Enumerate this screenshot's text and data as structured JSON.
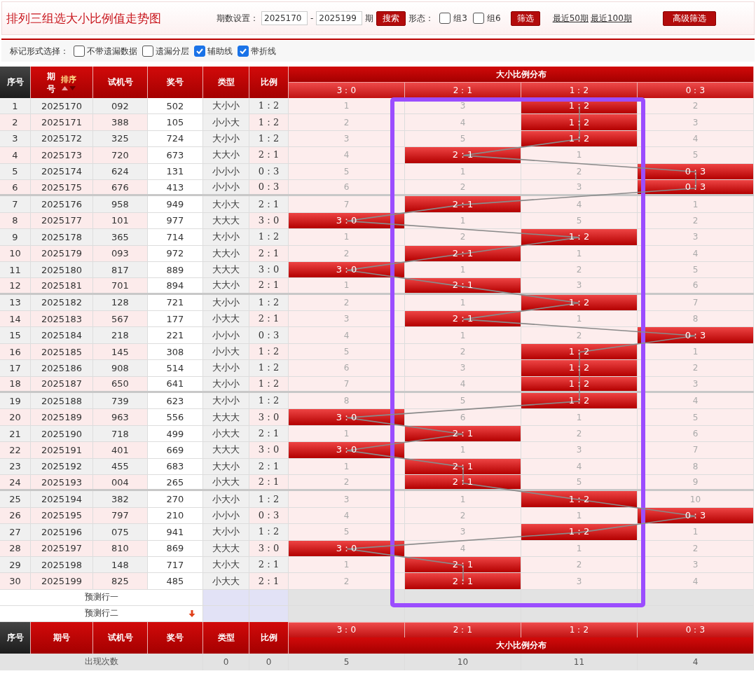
{
  "title": "排列三组选大小比例值走势图",
  "toolbar": {
    "period_label": "期数设置：",
    "period_from": "2025170",
    "period_separator": "-",
    "period_to": "2025199",
    "period_suffix": "期",
    "search_button": "搜索",
    "form_label": "形态：",
    "forms": [
      {
        "label": "组3",
        "checked": false
      },
      {
        "label": "组6",
        "checked": false
      }
    ],
    "filter_button": "筛选",
    "links": [
      "最近50期",
      "最近100期"
    ],
    "advanced_button": "高级筛选"
  },
  "mark_options": {
    "label": "标记形式选择：",
    "options": [
      {
        "label": "不带遗漏数据",
        "checked": false
      },
      {
        "label": "遗漏分层",
        "checked": false
      },
      {
        "label": "辅助线",
        "checked": true
      },
      {
        "label": "带折线",
        "checked": true
      }
    ]
  },
  "table": {
    "columns": [
      "序号",
      "期号",
      "试机号",
      "奖号",
      "类型",
      "比例"
    ],
    "sort_label": "排序",
    "distribution_title": "大小比例分布",
    "distribution_columns": [
      "3：0",
      "2：1",
      "1：2",
      "0：3"
    ],
    "rows": [
      {
        "seq": "1",
        "period": "2025170",
        "trial": "092",
        "prize": "502",
        "type": "大小小",
        "ratio": "1：2",
        "cells": [
          {
            "text": "1",
            "hit": false
          },
          {
            "text": "3",
            "hit": false
          },
          {
            "text": "1：2",
            "hit": true
          },
          {
            "text": "2",
            "hit": false
          }
        ]
      },
      {
        "seq": "2",
        "period": "2025171",
        "trial": "388",
        "prize": "105",
        "type": "小小大",
        "ratio": "1：2",
        "cells": [
          {
            "text": "2",
            "hit": false
          },
          {
            "text": "4",
            "hit": false
          },
          {
            "text": "1：2",
            "hit": true
          },
          {
            "text": "3",
            "hit": false
          }
        ]
      },
      {
        "seq": "3",
        "period": "2025172",
        "trial": "325",
        "prize": "724",
        "type": "大小小",
        "ratio": "1：2",
        "cells": [
          {
            "text": "3",
            "hit": false
          },
          {
            "text": "5",
            "hit": false
          },
          {
            "text": "1：2",
            "hit": true
          },
          {
            "text": "4",
            "hit": false
          }
        ]
      },
      {
        "seq": "4",
        "period": "2025173",
        "trial": "720",
        "prize": "673",
        "type": "大大小",
        "ratio": "2：1",
        "cells": [
          {
            "text": "4",
            "hit": false
          },
          {
            "text": "2：1",
            "hit": true
          },
          {
            "text": "1",
            "hit": false
          },
          {
            "text": "5",
            "hit": false
          }
        ]
      },
      {
        "seq": "5",
        "period": "2025174",
        "trial": "624",
        "prize": "131",
        "type": "小小小",
        "ratio": "0：3",
        "cells": [
          {
            "text": "5",
            "hit": false
          },
          {
            "text": "1",
            "hit": false
          },
          {
            "text": "2",
            "hit": false
          },
          {
            "text": "0：3",
            "hit": true
          }
        ]
      },
      {
        "seq": "6",
        "period": "2025175",
        "trial": "676",
        "prize": "413",
        "type": "小小小",
        "ratio": "0：3",
        "cells": [
          {
            "text": "6",
            "hit": false
          },
          {
            "text": "2",
            "hit": false
          },
          {
            "text": "3",
            "hit": false
          },
          {
            "text": "0：3",
            "hit": true
          }
        ]
      },
      {
        "seq": "7",
        "period": "2025176",
        "trial": "958",
        "prize": "949",
        "type": "大小大",
        "ratio": "2：1",
        "cells": [
          {
            "text": "7",
            "hit": false
          },
          {
            "text": "2：1",
            "hit": true
          },
          {
            "text": "4",
            "hit": false
          },
          {
            "text": "1",
            "hit": false
          }
        ]
      },
      {
        "seq": "8",
        "period": "2025177",
        "trial": "101",
        "prize": "977",
        "type": "大大大",
        "ratio": "3：0",
        "cells": [
          {
            "text": "3：0",
            "hit": true
          },
          {
            "text": "1",
            "hit": false
          },
          {
            "text": "5",
            "hit": false
          },
          {
            "text": "2",
            "hit": false
          }
        ]
      },
      {
        "seq": "9",
        "period": "2025178",
        "trial": "365",
        "prize": "714",
        "type": "大小小",
        "ratio": "1：2",
        "cells": [
          {
            "text": "1",
            "hit": false
          },
          {
            "text": "2",
            "hit": false
          },
          {
            "text": "1：2",
            "hit": true
          },
          {
            "text": "3",
            "hit": false
          }
        ]
      },
      {
        "seq": "10",
        "period": "2025179",
        "trial": "093",
        "prize": "972",
        "type": "大大小",
        "ratio": "2：1",
        "cells": [
          {
            "text": "2",
            "hit": false
          },
          {
            "text": "2：1",
            "hit": true
          },
          {
            "text": "1",
            "hit": false
          },
          {
            "text": "4",
            "hit": false
          }
        ]
      },
      {
        "seq": "11",
        "period": "2025180",
        "trial": "817",
        "prize": "889",
        "type": "大大大",
        "ratio": "3：0",
        "cells": [
          {
            "text": "3：0",
            "hit": true
          },
          {
            "text": "1",
            "hit": false
          },
          {
            "text": "2",
            "hit": false
          },
          {
            "text": "5",
            "hit": false
          }
        ]
      },
      {
        "seq": "12",
        "period": "2025181",
        "trial": "701",
        "prize": "894",
        "type": "大大小",
        "ratio": "2：1",
        "cells": [
          {
            "text": "1",
            "hit": false
          },
          {
            "text": "2：1",
            "hit": true
          },
          {
            "text": "3",
            "hit": false
          },
          {
            "text": "6",
            "hit": false
          }
        ]
      },
      {
        "seq": "13",
        "period": "2025182",
        "trial": "128",
        "prize": "721",
        "type": "大小小",
        "ratio": "1：2",
        "cells": [
          {
            "text": "2",
            "hit": false
          },
          {
            "text": "1",
            "hit": false
          },
          {
            "text": "1：2",
            "hit": true
          },
          {
            "text": "7",
            "hit": false
          }
        ]
      },
      {
        "seq": "14",
        "period": "2025183",
        "trial": "567",
        "prize": "177",
        "type": "小大大",
        "ratio": "2：1",
        "cells": [
          {
            "text": "3",
            "hit": false
          },
          {
            "text": "2：1",
            "hit": true
          },
          {
            "text": "1",
            "hit": false
          },
          {
            "text": "8",
            "hit": false
          }
        ]
      },
      {
        "seq": "15",
        "period": "2025184",
        "trial": "218",
        "prize": "221",
        "type": "小小小",
        "ratio": "0：3",
        "cells": [
          {
            "text": "4",
            "hit": false
          },
          {
            "text": "1",
            "hit": false
          },
          {
            "text": "2",
            "hit": false
          },
          {
            "text": "0：3",
            "hit": true
          }
        ]
      },
      {
        "seq": "16",
        "period": "2025185",
        "trial": "145",
        "prize": "308",
        "type": "小小大",
        "ratio": "1：2",
        "cells": [
          {
            "text": "5",
            "hit": false
          },
          {
            "text": "2",
            "hit": false
          },
          {
            "text": "1：2",
            "hit": true
          },
          {
            "text": "1",
            "hit": false
          }
        ]
      },
      {
        "seq": "17",
        "period": "2025186",
        "trial": "908",
        "prize": "514",
        "type": "大小小",
        "ratio": "1：2",
        "cells": [
          {
            "text": "6",
            "hit": false
          },
          {
            "text": "3",
            "hit": false
          },
          {
            "text": "1：2",
            "hit": true
          },
          {
            "text": "2",
            "hit": false
          }
        ]
      },
      {
        "seq": "18",
        "period": "2025187",
        "trial": "650",
        "prize": "641",
        "type": "大小小",
        "ratio": "1：2",
        "cells": [
          {
            "text": "7",
            "hit": false
          },
          {
            "text": "4",
            "hit": false
          },
          {
            "text": "1：2",
            "hit": true
          },
          {
            "text": "3",
            "hit": false
          }
        ]
      },
      {
        "seq": "19",
        "period": "2025188",
        "trial": "739",
        "prize": "623",
        "type": "大小小",
        "ratio": "1：2",
        "cells": [
          {
            "text": "8",
            "hit": false
          },
          {
            "text": "5",
            "hit": false
          },
          {
            "text": "1：2",
            "hit": true
          },
          {
            "text": "4",
            "hit": false
          }
        ]
      },
      {
        "seq": "20",
        "period": "2025189",
        "trial": "963",
        "prize": "556",
        "type": "大大大",
        "ratio": "3：0",
        "cells": [
          {
            "text": "3：0",
            "hit": true
          },
          {
            "text": "6",
            "hit": false
          },
          {
            "text": "1",
            "hit": false
          },
          {
            "text": "5",
            "hit": false
          }
        ]
      },
      {
        "seq": "21",
        "period": "2025190",
        "trial": "718",
        "prize": "499",
        "type": "小大大",
        "ratio": "2：1",
        "cells": [
          {
            "text": "1",
            "hit": false
          },
          {
            "text": "2：1",
            "hit": true
          },
          {
            "text": "2",
            "hit": false
          },
          {
            "text": "6",
            "hit": false
          }
        ]
      },
      {
        "seq": "22",
        "period": "2025191",
        "trial": "401",
        "prize": "669",
        "type": "大大大",
        "ratio": "3：0",
        "cells": [
          {
            "text": "3：0",
            "hit": true
          },
          {
            "text": "1",
            "hit": false
          },
          {
            "text": "3",
            "hit": false
          },
          {
            "text": "7",
            "hit": false
          }
        ]
      },
      {
        "seq": "23",
        "period": "2025192",
        "trial": "455",
        "prize": "683",
        "type": "大大小",
        "ratio": "2：1",
        "cells": [
          {
            "text": "1",
            "hit": false
          },
          {
            "text": "2：1",
            "hit": true
          },
          {
            "text": "4",
            "hit": false
          },
          {
            "text": "8",
            "hit": false
          }
        ]
      },
      {
        "seq": "24",
        "period": "2025193",
        "trial": "004",
        "prize": "265",
        "type": "小大大",
        "ratio": "2：1",
        "cells": [
          {
            "text": "2",
            "hit": false
          },
          {
            "text": "2：1",
            "hit": true
          },
          {
            "text": "5",
            "hit": false
          },
          {
            "text": "9",
            "hit": false
          }
        ]
      },
      {
        "seq": "25",
        "period": "2025194",
        "trial": "382",
        "prize": "270",
        "type": "小大小",
        "ratio": "1：2",
        "cells": [
          {
            "text": "3",
            "hit": false
          },
          {
            "text": "1",
            "hit": false
          },
          {
            "text": "1：2",
            "hit": true
          },
          {
            "text": "10",
            "hit": false
          }
        ]
      },
      {
        "seq": "26",
        "period": "2025195",
        "trial": "797",
        "prize": "210",
        "type": "小小小",
        "ratio": "0：3",
        "cells": [
          {
            "text": "4",
            "hit": false
          },
          {
            "text": "2",
            "hit": false
          },
          {
            "text": "1",
            "hit": false
          },
          {
            "text": "0：3",
            "hit": true
          }
        ]
      },
      {
        "seq": "27",
        "period": "2025196",
        "trial": "075",
        "prize": "941",
        "type": "大小小",
        "ratio": "1：2",
        "cells": [
          {
            "text": "5",
            "hit": false
          },
          {
            "text": "3",
            "hit": false
          },
          {
            "text": "1：2",
            "hit": true
          },
          {
            "text": "1",
            "hit": false
          }
        ]
      },
      {
        "seq": "28",
        "period": "2025197",
        "trial": "810",
        "prize": "869",
        "type": "大大大",
        "ratio": "3：0",
        "cells": [
          {
            "text": "3：0",
            "hit": true
          },
          {
            "text": "4",
            "hit": false
          },
          {
            "text": "1",
            "hit": false
          },
          {
            "text": "2",
            "hit": false
          }
        ]
      },
      {
        "seq": "29",
        "period": "2025198",
        "trial": "148",
        "prize": "717",
        "type": "大小大",
        "ratio": "2：1",
        "cells": [
          {
            "text": "1",
            "hit": false
          },
          {
            "text": "2：1",
            "hit": true
          },
          {
            "text": "2",
            "hit": false
          },
          {
            "text": "3",
            "hit": false
          }
        ]
      },
      {
        "seq": "30",
        "period": "2025199",
        "trial": "825",
        "prize": "485",
        "type": "小大大",
        "ratio": "2：1",
        "cells": [
          {
            "text": "2",
            "hit": false
          },
          {
            "text": "2：1",
            "hit": true
          },
          {
            "text": "3",
            "hit": false
          },
          {
            "text": "4",
            "hit": false
          }
        ]
      }
    ],
    "prediction_rows": [
      "预测行一",
      "预测行二"
    ],
    "footer_columns": [
      "序号",
      "期号",
      "试机号",
      "奖号",
      "类型",
      "比例"
    ],
    "footer_distribution_columns": [
      "3：0",
      "2：1",
      "1：2",
      "0：3"
    ],
    "footer_distribution_title": "大小比例分布",
    "stats": [
      {
        "label": "出现次数",
        "values": [
          "0",
          "0",
          "5",
          "10",
          "11",
          "4"
        ]
      }
    ]
  }
}
